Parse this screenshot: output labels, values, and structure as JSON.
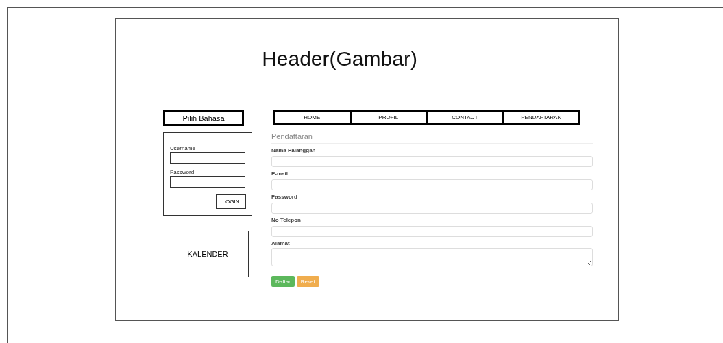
{
  "header": {
    "title": "Header(Gambar)"
  },
  "language_button": {
    "label": "Pilih Bahasa"
  },
  "login": {
    "fields": [
      {
        "label": "Username"
      },
      {
        "label": "Password"
      }
    ],
    "button": "LOGIN"
  },
  "calendar": {
    "label": "KALENDER"
  },
  "nav": [
    {
      "label": "HOME"
    },
    {
      "label": "PROFIL"
    },
    {
      "label": "CONTACT"
    },
    {
      "label": "PENDAFTARAN"
    }
  ],
  "form": {
    "title": "Pendaftaran",
    "fields": [
      {
        "label": "Nama Palanggan",
        "kind": "input"
      },
      {
        "label": "E-mail",
        "kind": "input"
      },
      {
        "label": "Password",
        "kind": "input"
      },
      {
        "label": "No Telepon",
        "kind": "input"
      },
      {
        "label": "Alamat",
        "kind": "textarea"
      }
    ],
    "buttons": [
      {
        "label": "Daftar",
        "kind": "success"
      },
      {
        "label": "Reset",
        "kind": "warning"
      }
    ]
  }
}
